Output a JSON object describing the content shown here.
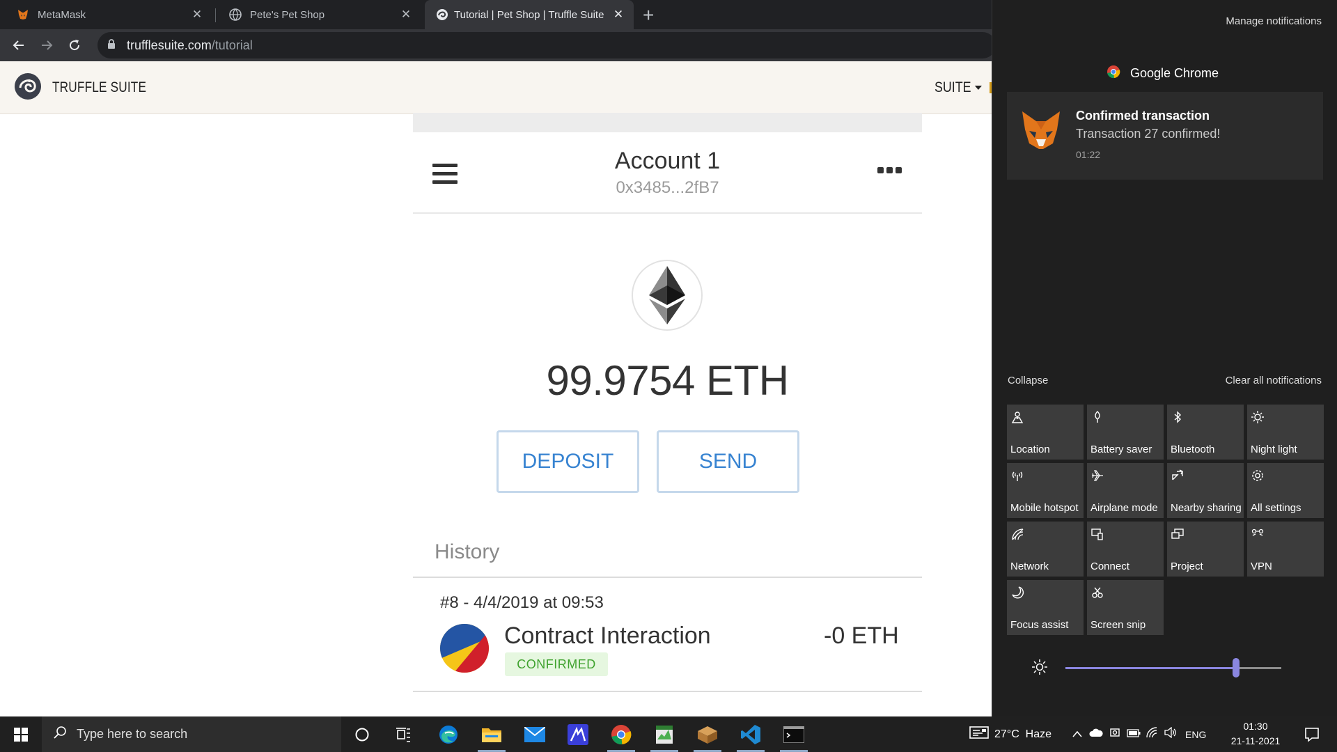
{
  "browser": {
    "tabs": [
      {
        "title": "MetaMask",
        "active": false
      },
      {
        "title": "Pete's Pet Shop",
        "active": false
      },
      {
        "title": "Tutorial | Pet Shop | Truffle Suite",
        "active": true
      }
    ],
    "url_host": "trufflesuite.com",
    "url_path": "/tutorial"
  },
  "truffle": {
    "brand": "TRUFFLE SUITE",
    "menu": "SUITE"
  },
  "metamask": {
    "account_name": "Account 1",
    "account_address": "0x3485...2fB7",
    "balance": "99.9754 ETH",
    "deposit_label": "DEPOSIT",
    "send_label": "SEND",
    "history_label": "History",
    "transactions": [
      {
        "meta": "#8 - 4/4/2019 at 09:53",
        "title": "Contract Interaction",
        "amount": "-0 ETH",
        "status": "CONFIRMED"
      }
    ]
  },
  "action_center": {
    "manage": "Manage notifications",
    "app_name": "Google Chrome",
    "notification": {
      "title": "Confirmed transaction",
      "body": "Transaction 27 confirmed!",
      "time": "01:22"
    },
    "collapse": "Collapse",
    "clear_all": "Clear all notifications",
    "quick_actions": [
      {
        "label": "Location",
        "icon": "location-icon"
      },
      {
        "label": "Battery saver",
        "icon": "battery-saver-icon"
      },
      {
        "label": "Bluetooth",
        "icon": "bluetooth-icon"
      },
      {
        "label": "Night light",
        "icon": "night-light-icon"
      },
      {
        "label": "Mobile hotspot",
        "icon": "mobile-hotspot-icon"
      },
      {
        "label": "Airplane mode",
        "icon": "airplane-icon"
      },
      {
        "label": "Nearby sharing",
        "icon": "nearby-sharing-icon"
      },
      {
        "label": "All settings",
        "icon": "gear-icon"
      },
      {
        "label": "Network",
        "icon": "network-icon"
      },
      {
        "label": "Connect",
        "icon": "connect-icon"
      },
      {
        "label": "Project",
        "icon": "project-icon"
      },
      {
        "label": "VPN",
        "icon": "vpn-icon"
      },
      {
        "label": "Focus assist",
        "icon": "moon-icon"
      },
      {
        "label": "Screen snip",
        "icon": "screen-snip-icon"
      }
    ],
    "brightness_level": 0.79
  },
  "taskbar": {
    "search_placeholder": "Type here to search",
    "weather": "27°C  Haze",
    "language": "ENG",
    "time": "01:30",
    "date": "21-11-2021"
  },
  "colors": {
    "accent_blue": "#3783d1",
    "confirmed_green": "#3fa22e",
    "slider_accent": "#8a86e0"
  }
}
